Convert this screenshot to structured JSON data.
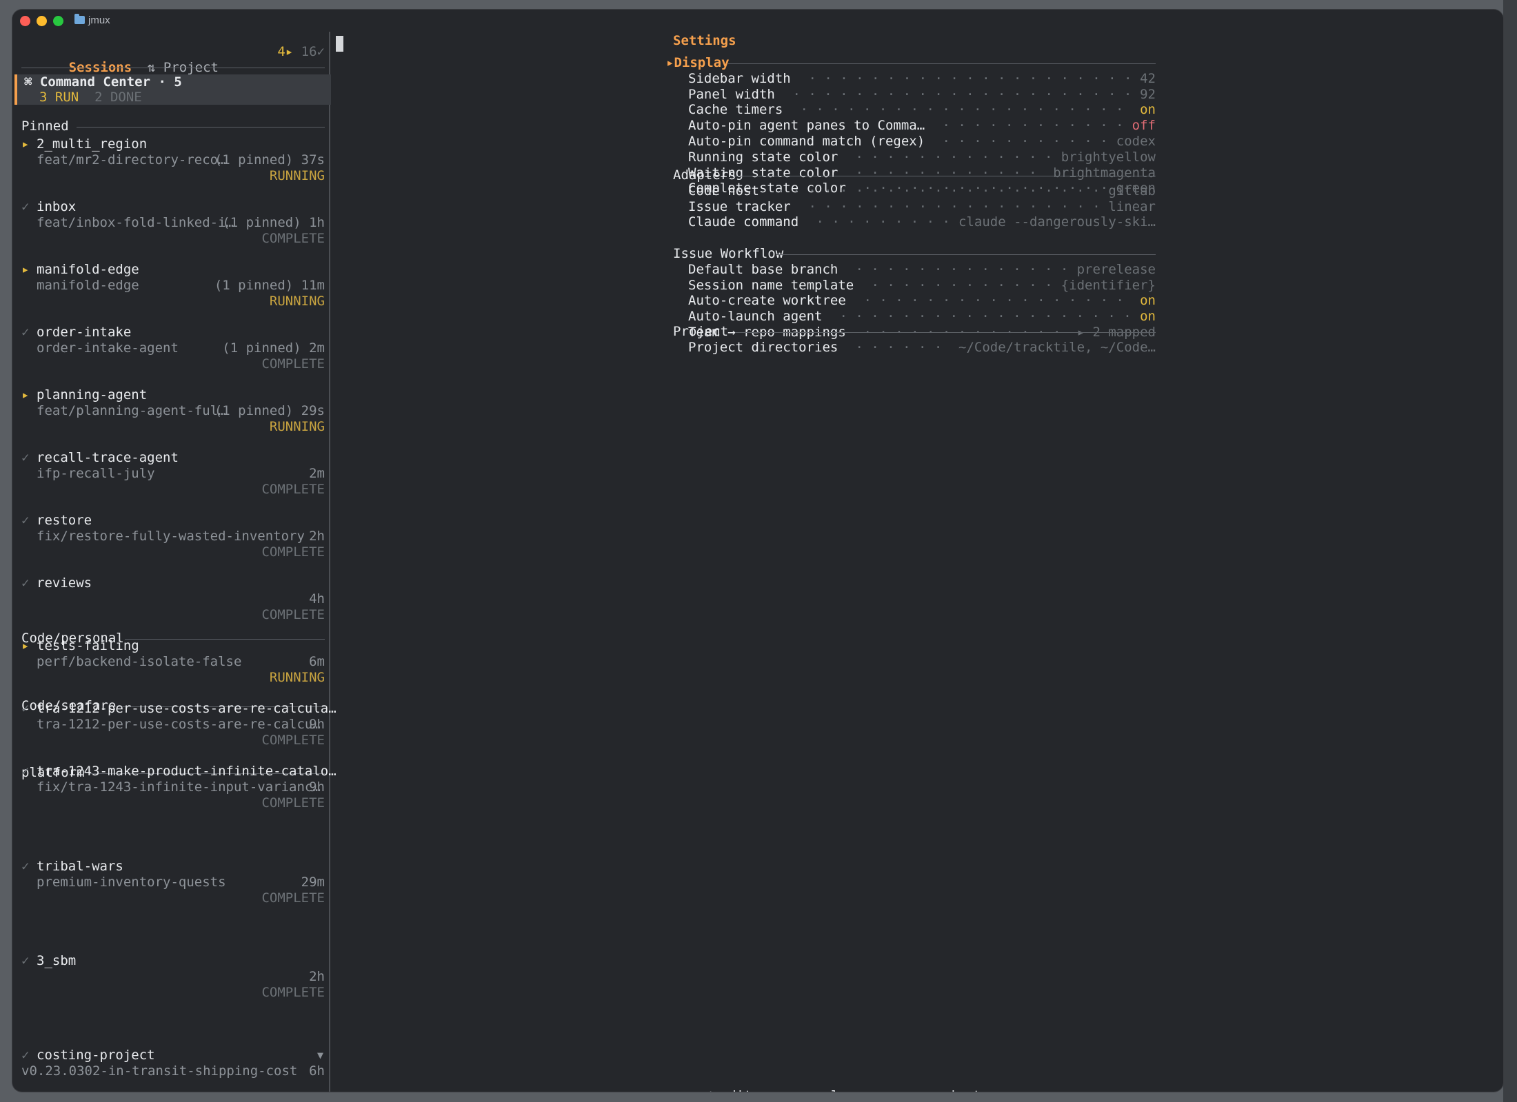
{
  "window": {
    "title": "jmux"
  },
  "sidebar": {
    "sessions_label": "Sessions",
    "project_label": "⇅ Project",
    "running_count": "4▸",
    "done_count": "16✓",
    "command_center": {
      "title": "⌘ Command Center · 5",
      "run": "3 RUN",
      "done": "2 DONE"
    },
    "groups": [
      {
        "label": "Pinned"
      },
      {
        "label": "Code/personal"
      },
      {
        "label": "Code/seafare"
      },
      {
        "label": "platform"
      }
    ],
    "sessions": [
      {
        "mark": "▸",
        "name": "2_multi_region",
        "branch": "feat/mr2-directory-reco…",
        "meta": "(1 pinned) 37s",
        "status": "RUNNING"
      },
      {
        "mark": "✓",
        "name": "inbox",
        "branch": "feat/inbox-fold-linked-i…",
        "meta": "(1 pinned) 1h",
        "status": "COMPLETE"
      },
      {
        "mark": "▸",
        "name": "manifold-edge",
        "branch": "manifold-edge",
        "meta": "(1 pinned) 11m",
        "status": "RUNNING"
      },
      {
        "mark": "✓",
        "name": "order-intake",
        "branch": "order-intake-agent",
        "meta": "(1 pinned) 2m",
        "status": "COMPLETE"
      },
      {
        "mark": "▸",
        "name": "planning-agent",
        "branch": "feat/planning-agent-ful…",
        "meta": "(1 pinned) 29s",
        "status": "RUNNING"
      },
      {
        "mark": "✓",
        "name": "recall-trace-agent",
        "branch": "ifp-recall-july",
        "meta": "2m",
        "status": "COMPLETE"
      },
      {
        "mark": "✓",
        "name": "restore",
        "branch": "fix/restore-fully-wasted-inventory",
        "meta": "2h",
        "status": "COMPLETE"
      },
      {
        "mark": "✓",
        "name": "reviews",
        "branch": "",
        "meta": "4h",
        "status": "COMPLETE"
      },
      {
        "mark": "▸",
        "name": "tests-failing",
        "branch": "perf/backend-isolate-false",
        "meta": "6m",
        "status": "RUNNING"
      },
      {
        "mark": "✓",
        "name": "tra-1212-per-use-costs-are-re-calcula…",
        "branch": "tra-1212-per-use-costs-are-re-calcu…",
        "meta": "9h",
        "status": "COMPLETE"
      },
      {
        "mark": "✓",
        "name": "tra-1243-make-product-infinite-catalo…",
        "branch": "fix/tra-1243-infinite-input-varianc…",
        "meta": "9h",
        "status": "COMPLETE"
      },
      {
        "mark": "✓",
        "name": "tribal-wars",
        "branch": "premium-inventory-quests",
        "meta": "29m",
        "status": "COMPLETE"
      },
      {
        "mark": "✓",
        "name": "3_sbm",
        "branch": "",
        "meta": "2h",
        "status": "COMPLETE"
      },
      {
        "mark": "✓",
        "name": "costing-project",
        "branch": "v0.23.0302-in-transit-shipping-cost",
        "meta": "6h",
        "status": ""
      }
    ],
    "scroll_indicator": "▼"
  },
  "settings": {
    "title": "Settings",
    "sections": [
      {
        "label": "▸Display",
        "items": [
          {
            "key": "Sidebar width",
            "value": "42"
          },
          {
            "key": "Panel width",
            "value": "92"
          },
          {
            "key": "Cache timers",
            "value": "on"
          },
          {
            "key": "Auto-pin agent panes to Comma…",
            "value": "off"
          },
          {
            "key": "Auto-pin command match (regex)",
            "value": "codex"
          },
          {
            "key": "Running state color",
            "value": "brightyellow"
          },
          {
            "key": "Waiting state color",
            "value": "brightmagenta"
          },
          {
            "key": "Complete state color",
            "value": "green"
          }
        ]
      },
      {
        "label": "Adapters",
        "items": [
          {
            "key": "Code host",
            "value": "gitlab"
          },
          {
            "key": "Issue tracker",
            "value": "linear"
          },
          {
            "key": "Claude command",
            "value": "claude --dangerously-ski…"
          }
        ]
      },
      {
        "label": "Issue Workflow",
        "items": [
          {
            "key": "Default base branch",
            "value": "prerelease"
          },
          {
            "key": "Session name template",
            "value": "{identifier}"
          },
          {
            "key": "Auto-create worktree",
            "value": "on"
          },
          {
            "key": "Auto-launch agent",
            "value": "on"
          },
          {
            "key": "Team → repo mappings",
            "value": "▸ 2 mapped"
          }
        ]
      },
      {
        "label": "Project",
        "items": [
          {
            "key": "Project directories",
            "value": "~/Code/tracktile, ~/Code…"
          }
        ]
      }
    ]
  },
  "footer": {
    "edit_key": "↲",
    "edit_label": "edit",
    "close_key": "esc",
    "close_label": "close",
    "nav_key": "↑↓",
    "nav_label": "navigate",
    "separator": "·"
  },
  "colors": {
    "accent": "#f6a04d",
    "running": "#c9a440",
    "complete": "#6b7075",
    "off": "#e06c75",
    "on": "#e2b93d"
  }
}
